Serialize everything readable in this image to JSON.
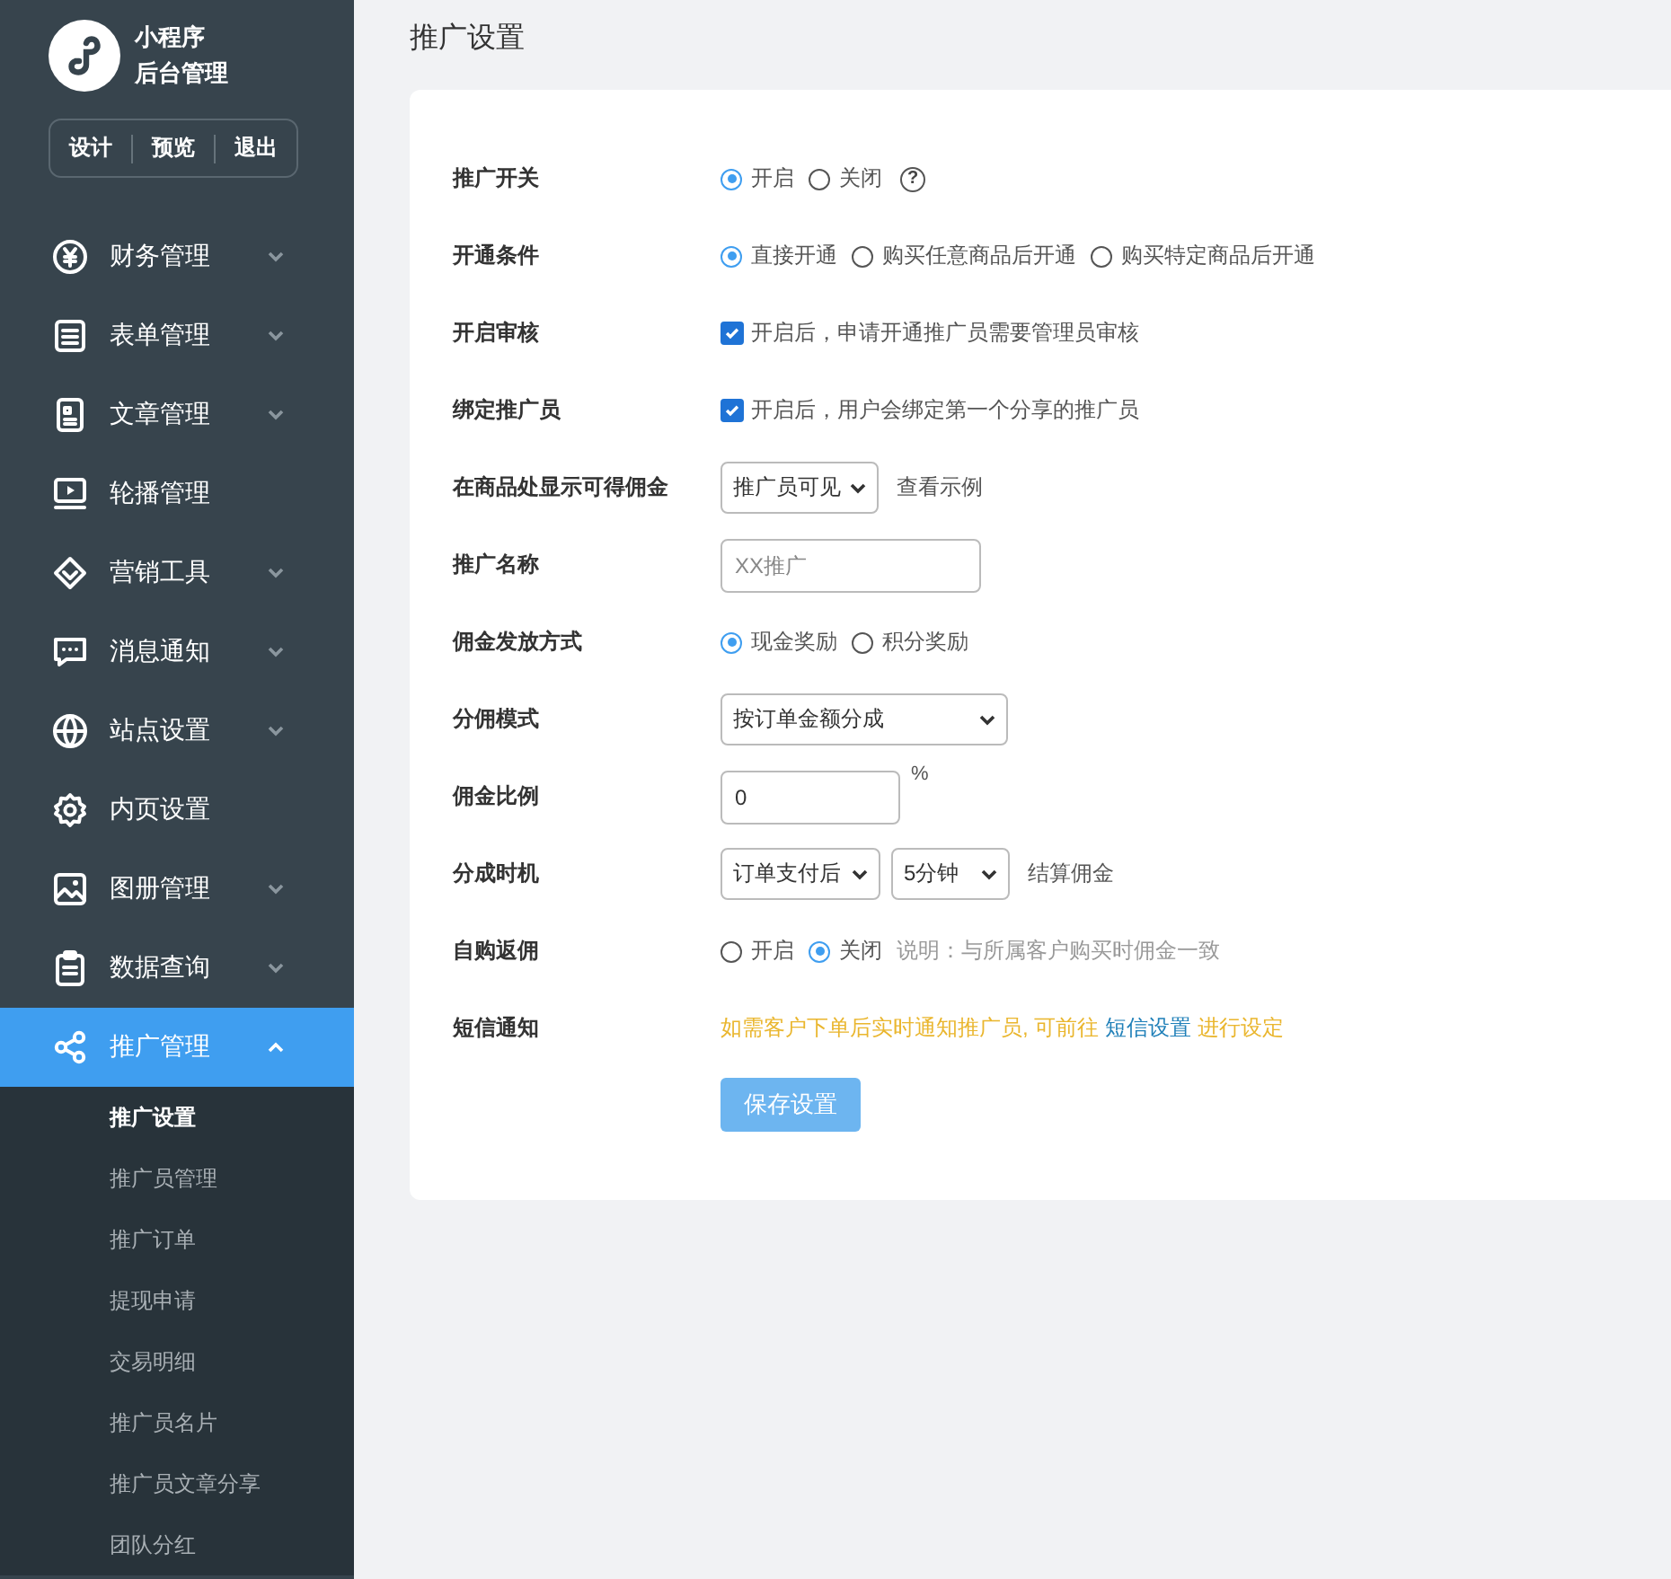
{
  "sidebar": {
    "brand": {
      "line1": "小程序",
      "line2": "后台管理"
    },
    "header_buttons": [
      "设计",
      "预览",
      "退出"
    ],
    "menu": [
      {
        "label": "财务管理",
        "kind": "group",
        "expanded": false,
        "selected": false
      },
      {
        "label": "表单管理",
        "kind": "group",
        "expanded": false,
        "selected": false
      },
      {
        "label": "文章管理",
        "kind": "group",
        "expanded": false,
        "selected": false
      },
      {
        "label": "轮播管理",
        "kind": "link",
        "selected": false
      },
      {
        "label": "营销工具",
        "kind": "group",
        "expanded": false,
        "selected": false
      },
      {
        "label": "消息通知",
        "kind": "group",
        "expanded": false,
        "selected": false
      },
      {
        "label": "站点设置",
        "kind": "group",
        "expanded": false,
        "selected": false
      },
      {
        "label": "内页设置",
        "kind": "link",
        "selected": false
      },
      {
        "label": "图册管理",
        "kind": "group",
        "expanded": false,
        "selected": false
      },
      {
        "label": "数据查询",
        "kind": "group",
        "expanded": false,
        "selected": false
      },
      {
        "label": "推广管理",
        "kind": "group",
        "expanded": true,
        "selected": true,
        "children": [
          {
            "label": "推广设置",
            "selected": true
          },
          {
            "label": "推广员管理",
            "selected": false
          },
          {
            "label": "推广订单",
            "selected": false
          },
          {
            "label": "提现申请",
            "selected": false
          },
          {
            "label": "交易明细",
            "selected": false
          },
          {
            "label": "推广员名片",
            "selected": false
          },
          {
            "label": "推广员文章分享",
            "selected": false
          },
          {
            "label": "团队分红",
            "selected": false
          }
        ]
      }
    ]
  },
  "page": {
    "title": "推广设置"
  },
  "form": {
    "rows": [
      {
        "label": "推广开关",
        "items": [
          {
            "kind": "radio",
            "label": "开启",
            "selected": true
          },
          {
            "kind": "radio",
            "label": "关闭",
            "selected": false
          },
          {
            "kind": "help",
            "symbol": "?"
          }
        ]
      },
      {
        "label": "开通条件",
        "items": [
          {
            "kind": "radio",
            "label": "直接开通",
            "selected": true
          },
          {
            "kind": "radio",
            "label": "购买任意商品后开通",
            "selected": false
          },
          {
            "kind": "radio",
            "label": "购买特定商品后开通",
            "selected": false
          }
        ]
      },
      {
        "label": "开启审核",
        "items": [
          {
            "kind": "checkbox",
            "label": "开启后，申请开通推广员需要管理员审核",
            "checked": true
          }
        ]
      },
      {
        "label": "绑定推广员",
        "items": [
          {
            "kind": "checkbox",
            "label": "开启后，用户会绑定第一个分享的推广员",
            "checked": true
          }
        ]
      },
      {
        "label": "在商品处显示可得佣金",
        "items": [
          {
            "kind": "select",
            "value": "推广员可见"
          },
          {
            "kind": "text",
            "text": "查看示例"
          }
        ]
      },
      {
        "label": "推广名称",
        "items": [
          {
            "kind": "input",
            "placeholder": "XX推广"
          }
        ]
      },
      {
        "label": "佣金发放方式",
        "items": [
          {
            "kind": "radio",
            "label": "现金奖励",
            "selected": true
          },
          {
            "kind": "radio",
            "label": "积分奖励",
            "selected": false
          }
        ]
      },
      {
        "label": "分佣模式",
        "items": [
          {
            "kind": "select",
            "value": "按订单金额分成"
          }
        ]
      },
      {
        "label": "佣金比例",
        "items": [
          {
            "kind": "input",
            "value": "0"
          },
          {
            "kind": "unit",
            "text": "%"
          }
        ]
      },
      {
        "label": "分成时机",
        "items": [
          {
            "kind": "select",
            "value": "订单支付后"
          },
          {
            "kind": "select",
            "value": "5分钟"
          },
          {
            "kind": "text",
            "text": "结算佣金"
          }
        ]
      },
      {
        "label": "自购返佣",
        "items": [
          {
            "kind": "radio",
            "label": "开启",
            "selected": false
          },
          {
            "kind": "radio",
            "label": "关闭",
            "selected": true
          },
          {
            "kind": "hint",
            "text": "说明：与所属客户购买时佣金一致"
          }
        ]
      },
      {
        "label": "短信通知",
        "items": [
          {
            "kind": "notice",
            "before": "如需客户下单后实时通知推广员, 可前往",
            "link": "短信设置",
            "after": "进行设定"
          }
        ]
      }
    ],
    "save_button": "保存设置"
  }
}
